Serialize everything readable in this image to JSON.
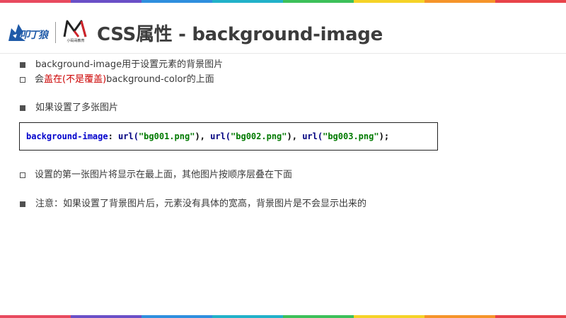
{
  "colors": {
    "stripe": [
      "#e84a5f",
      "#6a4fc7",
      "#2f8fde",
      "#21b1c9",
      "#3cc05a",
      "#f5d327",
      "#f5942a",
      "#e8434a"
    ],
    "title_text": "#3c3c3c",
    "highlight_red": "#cc0000",
    "code_property": "#0000cc",
    "code_string": "#007a00"
  },
  "header": {
    "logo_left_text": "叩丁狼",
    "logo_right_text": "小码哥教育",
    "title": "CSS属性 - background-image"
  },
  "bullets": {
    "b1": {
      "style": "filled-square",
      "text": "background-image用于设置元素的背景图片"
    },
    "b2": {
      "style": "hollow-square",
      "prefix": "会",
      "red_text": "盖在(不是覆盖)",
      "suffix": "background-color的上面"
    },
    "b3": {
      "style": "filled-square",
      "text": "如果设置了多张图片"
    },
    "b4": {
      "style": "hollow-square",
      "text": "设置的第一张图片将显示在最上面，其他图片按顺序层叠在下面"
    },
    "b5": {
      "style": "filled-square",
      "text": "注意：如果设置了背景图片后，元素没有具体的宽高，背景图片是不会显示出来的"
    }
  },
  "code": {
    "property": "background-image",
    "colon": ": ",
    "func1": "url(",
    "str1": "\"bg001.png\"",
    "sep1": "), ",
    "func2": "url(",
    "str2": "\"bg002.png\"",
    "sep2": "), ",
    "func3": "url(",
    "str3": "\"bg003.png\"",
    "end": ");"
  }
}
